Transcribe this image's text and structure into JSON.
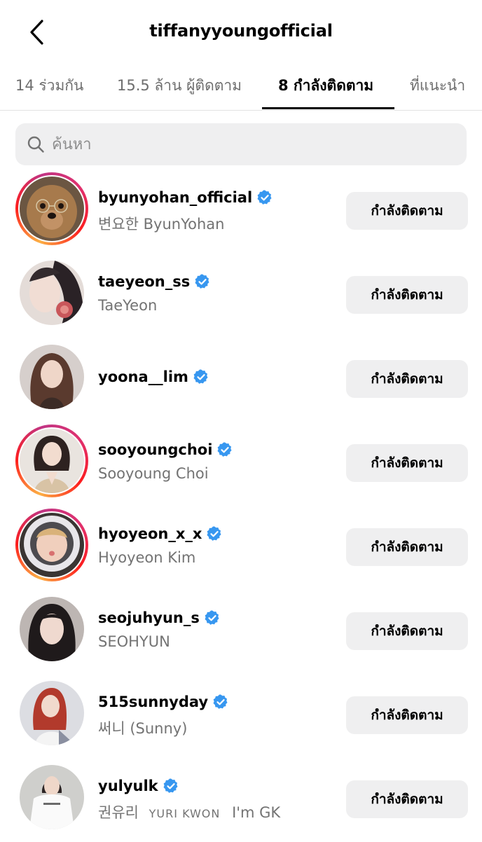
{
  "header": {
    "title": "tiffanyyoungofficial"
  },
  "tabs": [
    {
      "label": "14 ร่วมกัน"
    },
    {
      "label": "15.5 ล้าน ผู้ติดตาม"
    },
    {
      "label": "8 กำลังติดตาม"
    },
    {
      "label": "ที่แนะนำ"
    }
  ],
  "active_tab": 2,
  "search": {
    "placeholder": "ค้นหา",
    "value": ""
  },
  "icons": {
    "back": "chevron-left-icon",
    "search": "search-icon",
    "verified": "verified-badge-icon"
  },
  "colors": {
    "verified": "#3797f0",
    "button_bg": "#efeff0",
    "secondary_text": "#737373"
  },
  "following": [
    {
      "username": "byunyohan_official",
      "full_name": "변요한 ByunYohan",
      "verified": true,
      "story_ring": true,
      "button": "กำลังติดตาม"
    },
    {
      "username": "taeyeon_ss",
      "full_name": "TaeYeon",
      "verified": true,
      "story_ring": false,
      "button": "กำลังติดตาม"
    },
    {
      "username": "yoona__lim",
      "full_name": "",
      "verified": true,
      "story_ring": false,
      "button": "กำลังติดตาม"
    },
    {
      "username": "sooyoungchoi",
      "full_name": "Sooyoung Choi",
      "verified": true,
      "story_ring": true,
      "button": "กำลังติดตาม"
    },
    {
      "username": "hyoyeon_x_x",
      "full_name": "Hyoyeon Kim",
      "verified": true,
      "story_ring": true,
      "button": "กำลังติดตาม"
    },
    {
      "username": "seojuhyun_s",
      "full_name": "SEOHYUN",
      "verified": true,
      "story_ring": false,
      "button": "กำลังติดตาม"
    },
    {
      "username": "515sunnyday",
      "full_name": "써니 (Sunny)",
      "verified": true,
      "story_ring": false,
      "button": "กำลังติดตาม"
    },
    {
      "username": "yulyulk",
      "full_name_parts": [
        "권유리",
        "YURI KWON",
        "I'm GK"
      ],
      "verified": true,
      "story_ring": false,
      "button": "กำลังติดตาม"
    }
  ]
}
